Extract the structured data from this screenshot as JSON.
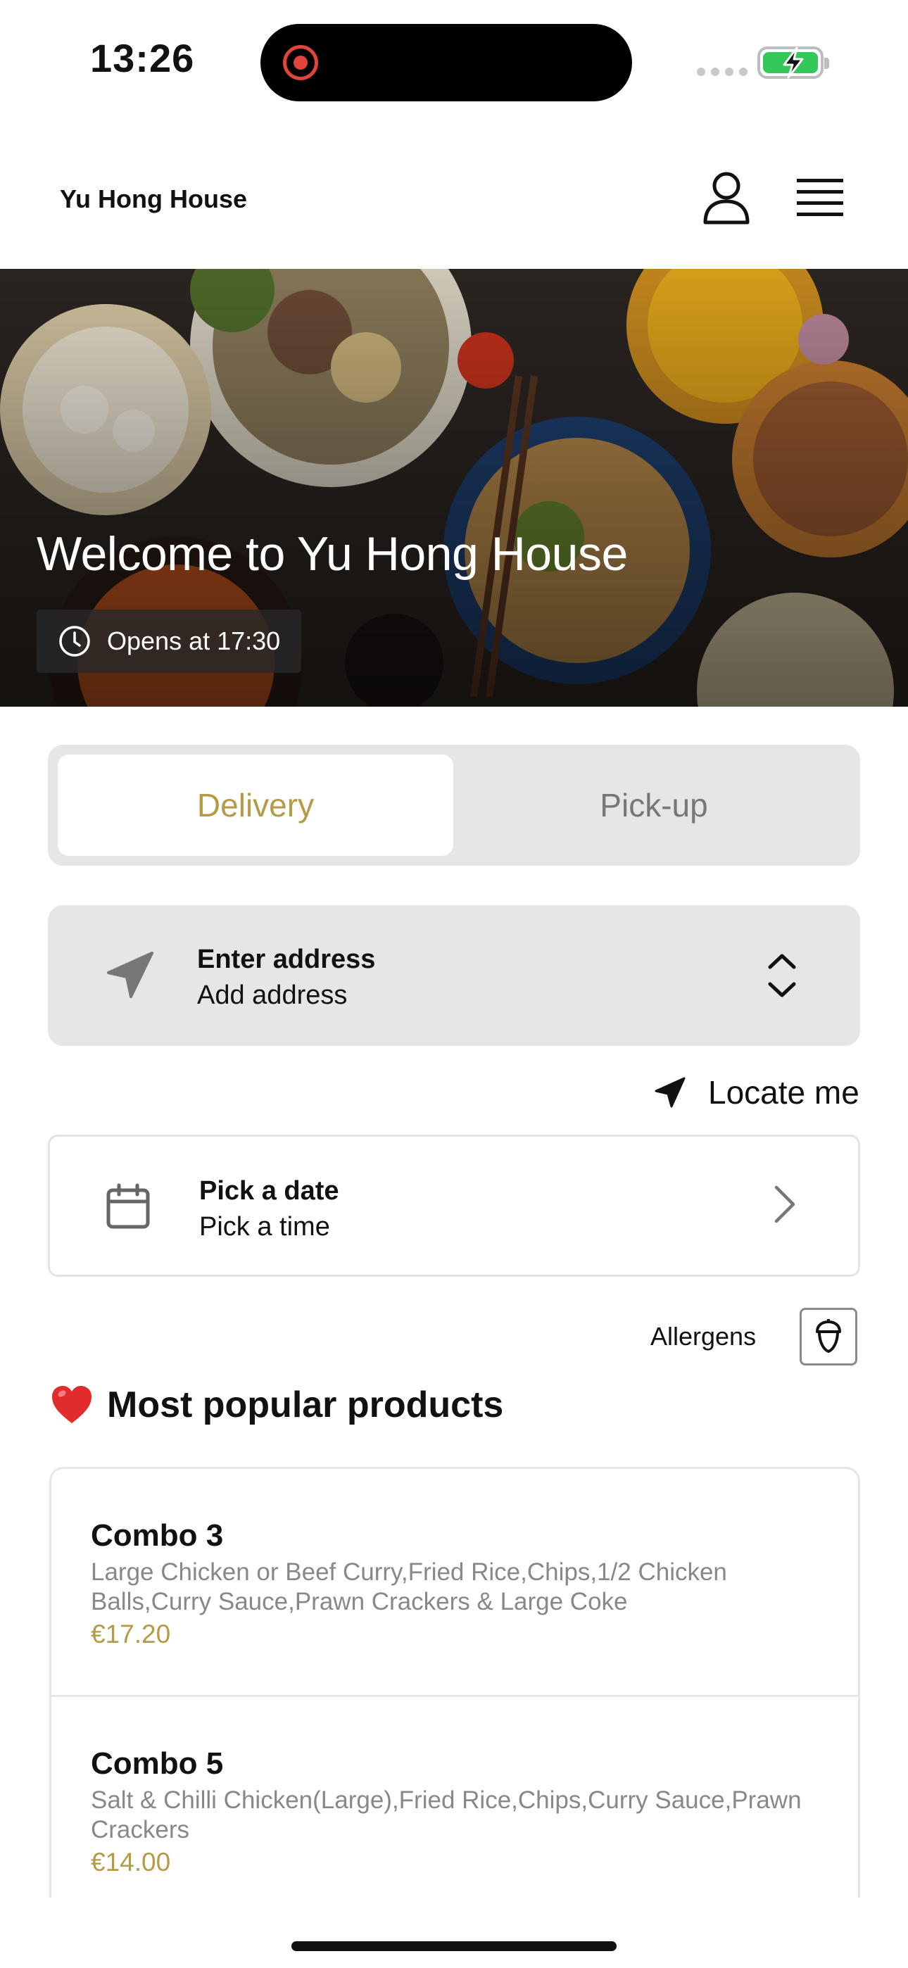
{
  "status_bar": {
    "time": "13:26"
  },
  "header": {
    "brand": "Yu Hong House"
  },
  "hero": {
    "title": "Welcome to Yu Hong House",
    "opens_label": "Opens at 17:30"
  },
  "tabs": [
    {
      "label": "Delivery",
      "active": true
    },
    {
      "label": "Pick-up",
      "active": false
    }
  ],
  "address": {
    "title": "Enter address",
    "subtitle": "Add address"
  },
  "locate": {
    "label": "Locate me"
  },
  "schedule": {
    "title": "Pick a date",
    "subtitle": "Pick a time"
  },
  "allergens": {
    "label": "Allergens"
  },
  "popular": {
    "title": "Most popular products",
    "items": [
      {
        "name": "Combo 3",
        "description": "Large Chicken or Beef Curry,Fried Rice,Chips,1/2 Chicken Balls,Curry Sauce,Prawn Crackers & Large Coke",
        "price": "€17.20"
      },
      {
        "name": "Combo 5",
        "description": "Salt & Chilli Chicken(Large),Fried Rice,Chips,Curry Sauce,Prawn Crackers",
        "price": "€14.00"
      }
    ]
  },
  "colors": {
    "accent": "#b59b45",
    "panel": "#e6e6e6",
    "battery": "#34c759",
    "record": "#e0443a"
  }
}
